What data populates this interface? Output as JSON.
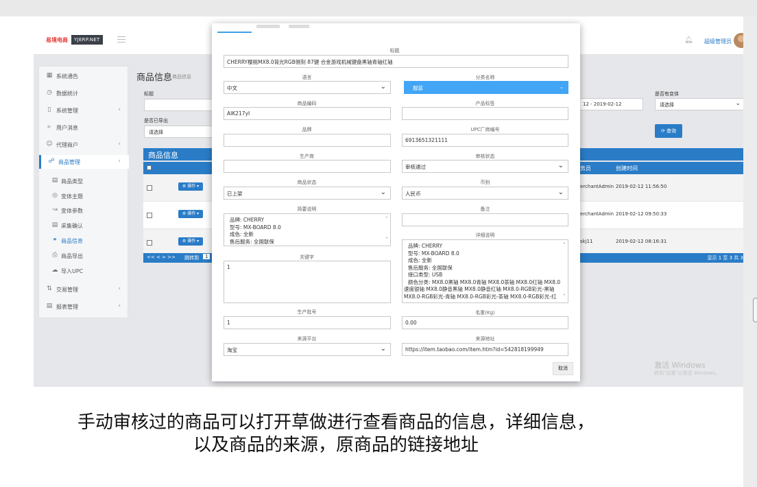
{
  "app": {
    "brand": "易境电商",
    "brand_tag": "YJERP.NET",
    "admin_name": "超级管理员"
  },
  "sidebar": {
    "items": [
      {
        "label": "系统通告",
        "icon": "book-icon"
      },
      {
        "label": "数据统计",
        "icon": "clock-icon"
      },
      {
        "label": "系统管理",
        "icon": "page-icon"
      },
      {
        "label": "用户消息",
        "icon": "speaker-icon"
      },
      {
        "label": "代理商户",
        "icon": "user-icon"
      },
      {
        "label": "商品管理",
        "icon": "cart-icon"
      }
    ],
    "sub_items": [
      {
        "label": "商品类型"
      },
      {
        "label": "变体主题"
      },
      {
        "label": "变体参数"
      },
      {
        "label": "采集确认"
      },
      {
        "label": "商品信息"
      },
      {
        "label": "商品导出"
      },
      {
        "label": "导入UPC"
      }
    ],
    "bottom_items": [
      {
        "label": "交易管理"
      },
      {
        "label": "报表管理"
      }
    ]
  },
  "main": {
    "title": "商品信息",
    "subtitle": "商品信息",
    "filter_title_label": "标题",
    "filter_exported_label": "是否已导出",
    "filter_exported_value": "请选择",
    "filter_date_value": "12 - 2019-02-12",
    "filter_variant_label": "是否有变体",
    "filter_variant_value": "请选择",
    "search_button": "查询",
    "table_title": "商品信息",
    "col_staff": "务员",
    "col_created": "创建时间",
    "row_op_label": "操作",
    "rows": [
      {
        "staff": "erchantAdmin",
        "created": "2019-02-12 11:56:50"
      },
      {
        "staff": "erchantAdmin",
        "created": "2019-02-12 09:50:33"
      },
      {
        "staff": "skj11",
        "created": "2019-02-12 08:16:31"
      }
    ],
    "pager_goto": "跳转到",
    "pager_page": "1",
    "pager_summary": "显示 1 至 3 共 3"
  },
  "windows_watermark": {
    "line1": "激活 Windows",
    "line2": "转到\"设置\"以激活 Windows。"
  },
  "modal": {
    "title_label": "标题",
    "title_value": "CHERRY樱桃MX8.0背光RGB侧刻 87键 合金游戏机械键盘黑轴青轴红轴",
    "language_label": "语言",
    "language_value": "中文",
    "category_label": "分类名称",
    "category_value": "服装",
    "code_label": "商品编码",
    "code_value": "AIK217yI",
    "tag_label": "产品标签",
    "tag_value": "",
    "brand_label": "品牌",
    "brand_value": "",
    "upc_label": "UPC厂商编号",
    "upc_value": "6913651321111",
    "maker_label": "生产商",
    "maker_value": "",
    "audit_label": "审核状态",
    "audit_value": "审核通过",
    "status_label": "商品状态",
    "status_value": "已上架",
    "currency_label": "币别",
    "currency_value": "人民币",
    "brief_label": "简要说明",
    "brief_lines": [
      "品牌: CHERRY",
      "型号: MX-BOARD 8.0",
      "成色: 全新",
      "售后服务: 全国联保"
    ],
    "remark_label": "备注",
    "remark_value": "",
    "detail_label": "详细说明",
    "detail_lines": [
      "品牌: CHERRY",
      "型号: MX-BOARD 8.0",
      "成色: 全新",
      "售后服务: 全国联保",
      "接口类型: USB",
      "颜色分类: MX8.0黑轴 MX8.0青轴 MX8.0茶轴 MX8.0红轴 MX8.0",
      "速度银轴 MX8.0静音黑轴 MX8.0静音红轴 MX8.0-RGB彩光-黑轴",
      "MX8.0-RGB彩光-青轴 MX8.0-RGB彩光-茶轴 MX8.0-RGB彩光-红"
    ],
    "keywords_label": "关键字",
    "keywords_value": "1",
    "batch_label": "生产批号",
    "batch_value": "1",
    "weight_label": "毛重(Kg)",
    "weight_value": "0.00",
    "platform_label": "来源平台",
    "platform_value": "淘宝",
    "source_label": "来源地址",
    "source_value": "https://item.taobao.com/item.htm?id=542818199949",
    "cancel_button": "取消"
  },
  "caption": {
    "line1": "手动审核过的商品可以打开草做进行查看商品的信息，详细信息，",
    "line2": "以及商品的来源，原商品的链接地址"
  },
  "colors": {
    "accent": "#2a7cc7",
    "select_highlight": "#42a5f5",
    "brand_red": "#e53935"
  }
}
